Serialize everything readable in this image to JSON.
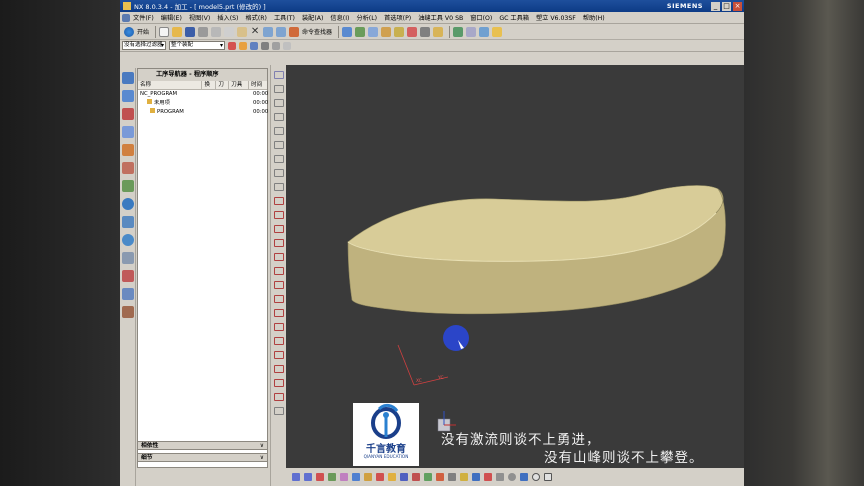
{
  "window": {
    "title": "NX 8.0.3.4 - 加工 - [ model5.prt  (修改的) ]",
    "brand": "SIEMENS",
    "minimize": "_",
    "maximize": "□",
    "close": "×"
  },
  "menubar": {
    "items": [
      "文件(F)",
      "编辑(E)",
      "视图(V)",
      "插入(S)",
      "格式(R)",
      "工具(T)",
      "装配(A)",
      "信息(I)",
      "分析(L)",
      "首选项(P)",
      "油缝工具 V0 SB",
      "窗口(O)",
      "GC 工具箱",
      "塑立 V6.03SF",
      "帮助(H)"
    ]
  },
  "toolbar": {
    "start_label": "开始",
    "command_finder_label": "命令查找器"
  },
  "toolbar2": {
    "filter_value": "没有选择过滤器",
    "assembly_value": "整个装配"
  },
  "navigator": {
    "title": "工序导航器 - 程序顺序",
    "columns": [
      "名称",
      "换",
      "刀",
      "刀具",
      "时间"
    ],
    "rows": [
      {
        "name": "NC_PROGRAM",
        "time": "00:00"
      },
      {
        "name": "未用项",
        "time": "00:00"
      },
      {
        "name": "PROGRAM",
        "time": "00:00"
      }
    ],
    "dependencies_label": "相依性",
    "details_label": "细节",
    "tab_chevron": "∨"
  },
  "viewport": {
    "triad_labels": [
      "XC",
      "YC"
    ],
    "model_color": "#c8bb84",
    "background": "#3a3a3a"
  },
  "subtitles": {
    "line1": "没有激流则谈不上勇进，",
    "line2": "没有山峰则谈不上攀登。"
  },
  "logo": {
    "name_cn": "千言教育",
    "name_en": "QIANYAN EDUCATION"
  }
}
